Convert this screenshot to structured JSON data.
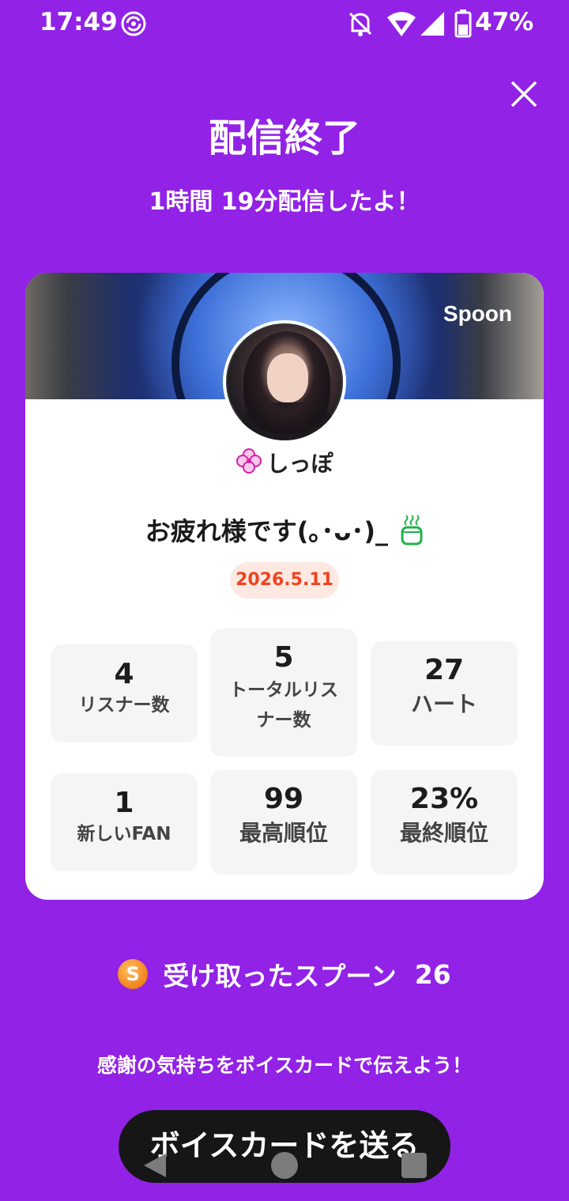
{
  "status_bar": {
    "time": "17:49",
    "battery": "47%",
    "icons": [
      "hotspot-icon",
      "mute-icon",
      "wifi-icon",
      "signal-icon",
      "battery-icon"
    ]
  },
  "header": {
    "title": "配信終了",
    "duration": "1時間 19分配信したよ！",
    "close_icon": "close-icon"
  },
  "card": {
    "brand": "Spoon",
    "username": "しっぽ",
    "live_title": "お疲れ様です(｡･ᴗ･)_",
    "date": "2026.5.11",
    "stats": [
      {
        "value": "4",
        "label": "リスナー数"
      },
      {
        "value": "5",
        "label": "トータルリス ナー数"
      },
      {
        "value": "27",
        "label": "ハート"
      },
      {
        "value": "1",
        "label": "新しいFAN"
      },
      {
        "value": "99",
        "label": "最高順位"
      },
      {
        "value": "23%",
        "label": "最終順位"
      }
    ]
  },
  "spoons": {
    "coin_letter": "S",
    "label": "受け取ったスプーン",
    "count": "26"
  },
  "thanks_text": "感謝の気持ちをボイスカードで伝えよう！",
  "voice_card_button": "ボイスカードを送る",
  "colors": {
    "background": "#9222e6",
    "card": "#ffffff",
    "date_badge_bg": "#fde9e2",
    "date_badge_text": "#f0421e",
    "button_bg": "#161616"
  }
}
